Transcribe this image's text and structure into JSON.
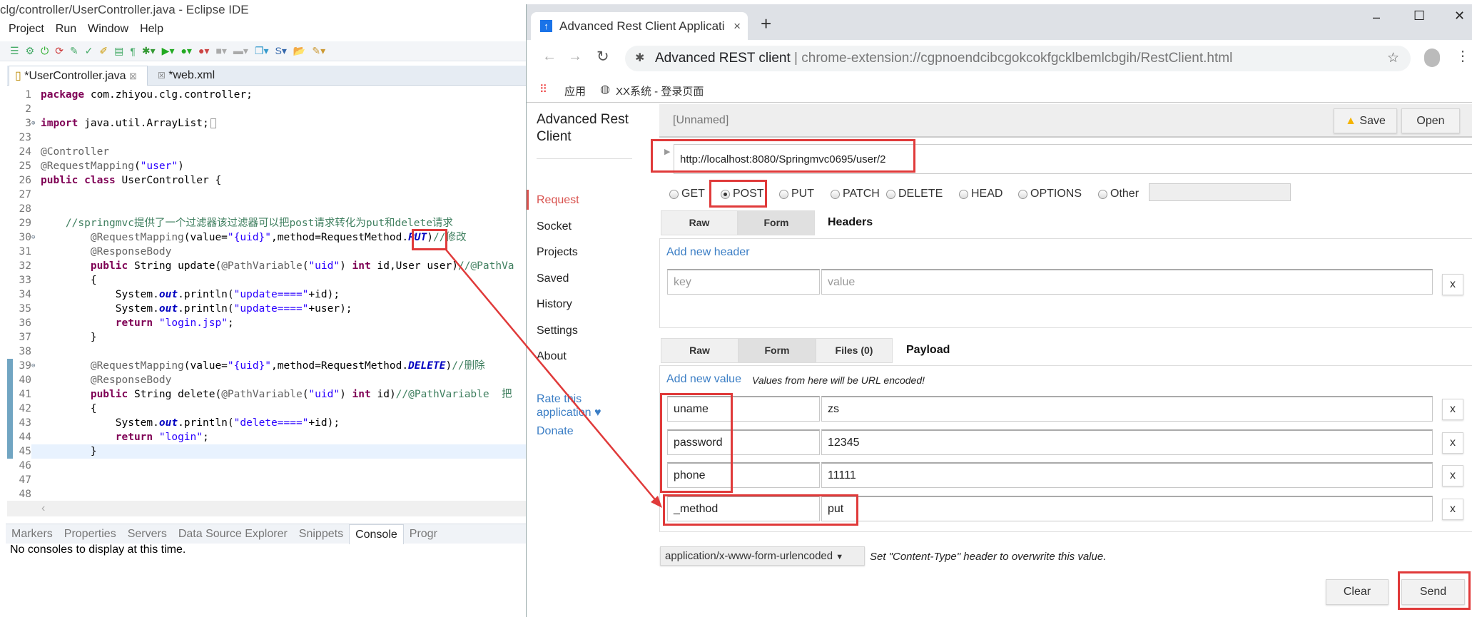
{
  "eclipse": {
    "title": "clg/controller/UserController.java - Eclipse IDE",
    "menu": [
      "Project",
      "Run",
      "Window",
      "Help"
    ],
    "tabs": [
      {
        "label": "*UserController.java",
        "close": "⊠"
      },
      {
        "label": "*web.xml"
      }
    ],
    "code": [
      {
        "n": "1",
        "t": [
          [
            "k",
            "package"
          ],
          [
            "p",
            " com.zhiyou.clg.controller;"
          ]
        ]
      },
      {
        "n": "2",
        "t": []
      },
      {
        "n": "3",
        "t": [
          [
            "k",
            "import"
          ],
          [
            "p",
            " java.util.ArrayList;"
          ]
        ],
        "marker": "⊕"
      },
      {
        "n": "23",
        "t": []
      },
      {
        "n": "24",
        "t": [
          [
            "a",
            "@Controller"
          ]
        ]
      },
      {
        "n": "25",
        "t": [
          [
            "a",
            "@RequestMapping"
          ],
          [
            "p",
            "("
          ],
          [
            "s",
            "\"user\""
          ],
          [
            "p",
            ")"
          ]
        ]
      },
      {
        "n": "26",
        "t": [
          [
            "k",
            "public"
          ],
          [
            "p",
            " "
          ],
          [
            "k",
            "class"
          ],
          [
            "p",
            " UserController {"
          ]
        ]
      },
      {
        "n": "27",
        "t": []
      },
      {
        "n": "28",
        "t": []
      },
      {
        "n": "29",
        "t": [
          [
            "p",
            "    "
          ],
          [
            "c",
            "//springmvc提供了一个过滤器该过滤器可以把post请求转化为put和delete请求"
          ]
        ]
      },
      {
        "n": "30",
        "t": [
          [
            "p",
            "        "
          ],
          [
            "a",
            "@RequestMapping"
          ],
          [
            "p",
            "(value="
          ],
          [
            "s",
            "\"{uid}\""
          ],
          [
            "p",
            ",method=RequestMethod."
          ],
          [
            "f",
            "PUT"
          ],
          [
            "p",
            ")"
          ],
          [
            "c",
            "//修改"
          ]
        ],
        "marker": "⊖"
      },
      {
        "n": "31",
        "t": [
          [
            "p",
            "        "
          ],
          [
            "a",
            "@ResponseBody"
          ]
        ]
      },
      {
        "n": "32",
        "t": [
          [
            "p",
            "        "
          ],
          [
            "k",
            "public"
          ],
          [
            "p",
            " String update("
          ],
          [
            "a",
            "@PathVariable"
          ],
          [
            "p",
            "("
          ],
          [
            "s",
            "\"uid\""
          ],
          [
            "p",
            ") "
          ],
          [
            "k",
            "int"
          ],
          [
            "p",
            " id,User user)"
          ],
          [
            "c",
            "//@PathVa"
          ]
        ]
      },
      {
        "n": "33",
        "t": [
          [
            "p",
            "        {"
          ]
        ]
      },
      {
        "n": "34",
        "t": [
          [
            "p",
            "            System."
          ],
          [
            "f",
            "out"
          ],
          [
            "p",
            ".println("
          ],
          [
            "s",
            "\"update====\""
          ],
          [
            "p",
            "+id);"
          ]
        ]
      },
      {
        "n": "35",
        "t": [
          [
            "p",
            "            System."
          ],
          [
            "f",
            "out"
          ],
          [
            "p",
            ".println("
          ],
          [
            "s",
            "\"update====\""
          ],
          [
            "p",
            "+user);"
          ]
        ]
      },
      {
        "n": "36",
        "t": [
          [
            "p",
            "            "
          ],
          [
            "k",
            "return"
          ],
          [
            "p",
            " "
          ],
          [
            "s",
            "\"login.jsp\""
          ],
          [
            "p",
            ";"
          ]
        ]
      },
      {
        "n": "37",
        "t": [
          [
            "p",
            "        }"
          ]
        ]
      },
      {
        "n": "38",
        "t": []
      },
      {
        "n": "39",
        "t": [
          [
            "p",
            "        "
          ],
          [
            "a",
            "@RequestMapping"
          ],
          [
            "p",
            "(value="
          ],
          [
            "s",
            "\"{uid}\""
          ],
          [
            "p",
            ",method=RequestMethod."
          ],
          [
            "f",
            "DELETE"
          ],
          [
            "p",
            ")"
          ],
          [
            "c",
            "//删除"
          ]
        ],
        "marker": "⊖"
      },
      {
        "n": "40",
        "t": [
          [
            "p",
            "        "
          ],
          [
            "a",
            "@ResponseBody"
          ]
        ]
      },
      {
        "n": "41",
        "t": [
          [
            "p",
            "        "
          ],
          [
            "k",
            "public"
          ],
          [
            "p",
            " String delete("
          ],
          [
            "a",
            "@PathVariable"
          ],
          [
            "p",
            "("
          ],
          [
            "s",
            "\"uid\""
          ],
          [
            "p",
            ") "
          ],
          [
            "k",
            "int"
          ],
          [
            "p",
            " id)"
          ],
          [
            "c",
            "//@PathVariable  把"
          ]
        ]
      },
      {
        "n": "42",
        "t": [
          [
            "p",
            "        {"
          ]
        ]
      },
      {
        "n": "43",
        "t": [
          [
            "p",
            "            System."
          ],
          [
            "f",
            "out"
          ],
          [
            "p",
            ".println("
          ],
          [
            "s",
            "\"delete====\""
          ],
          [
            "p",
            "+id);"
          ]
        ]
      },
      {
        "n": "44",
        "t": [
          [
            "p",
            "            "
          ],
          [
            "k",
            "return"
          ],
          [
            "p",
            " "
          ],
          [
            "s",
            "\"login\""
          ],
          [
            "p",
            ";"
          ]
        ]
      },
      {
        "n": "45",
        "t": [
          [
            "p",
            "        }"
          ]
        ],
        "current": true
      },
      {
        "n": "46",
        "t": []
      },
      {
        "n": "47",
        "t": []
      },
      {
        "n": "48",
        "t": []
      }
    ],
    "bottom_tabs": [
      "Markers",
      "Properties",
      "Servers",
      "Data Source Explorer",
      "Snippets",
      "Console",
      "Progr"
    ],
    "bottom_active": "Console",
    "console_message": "No consoles to display at this time."
  },
  "browser": {
    "tab_title": "Advanced Rest Client Applicati",
    "new_tab": "+",
    "window_controls": {
      "minimize": "–",
      "maximize": "☐",
      "close": "✕"
    },
    "omnibox_site": "Advanced REST client",
    "omnibox_url": "chrome-extension://cgpnoendcibcgokcokfgcklbemlcbgih/RestClient.html",
    "bookmarks": [
      {
        "icon": "apps-grid-icon",
        "label": "应用"
      },
      {
        "icon": "globe-icon",
        "label": "XX系统 - 登录页面"
      }
    ]
  },
  "app": {
    "title": "Advanced Rest Client",
    "nav": [
      "Request",
      "Socket",
      "Projects",
      "Saved",
      "History",
      "Settings",
      "About"
    ],
    "nav_active": "Request",
    "links": [
      "Rate this application ♥",
      "Donate"
    ],
    "request_name": "[Unnamed]",
    "save_label": "Save",
    "open_label": "Open",
    "url": "http://localhost:8080/Springmvc0695/user/2",
    "methods": [
      "GET",
      "POST",
      "PUT",
      "PATCH",
      "DELETE",
      "HEAD",
      "OPTIONS",
      "Other"
    ],
    "method_selected": "POST",
    "headers": {
      "tabs": [
        "Raw",
        "Form"
      ],
      "title": "Headers",
      "add_link": "Add new header",
      "key_placeholder": "key",
      "value_placeholder": "value",
      "remove": "x"
    },
    "payload": {
      "tabs": [
        "Raw",
        "Form",
        "Files (0)"
      ],
      "title": "Payload",
      "add_link": "Add new value",
      "note": "Values from here will be URL encoded!",
      "rows": [
        {
          "key": "uname",
          "value": "zs"
        },
        {
          "key": "password",
          "value": "12345"
        },
        {
          "key": "phone",
          "value": "11111"
        },
        {
          "key": "_method",
          "value": "put"
        }
      ],
      "remove": "x"
    },
    "content_type": "application/x-www-form-urlencoded",
    "content_type_note": "Set \"Content-Type\" header to overwrite this value.",
    "clear_label": "Clear",
    "send_label": "Send"
  },
  "annotation_color": "#e03a3a"
}
